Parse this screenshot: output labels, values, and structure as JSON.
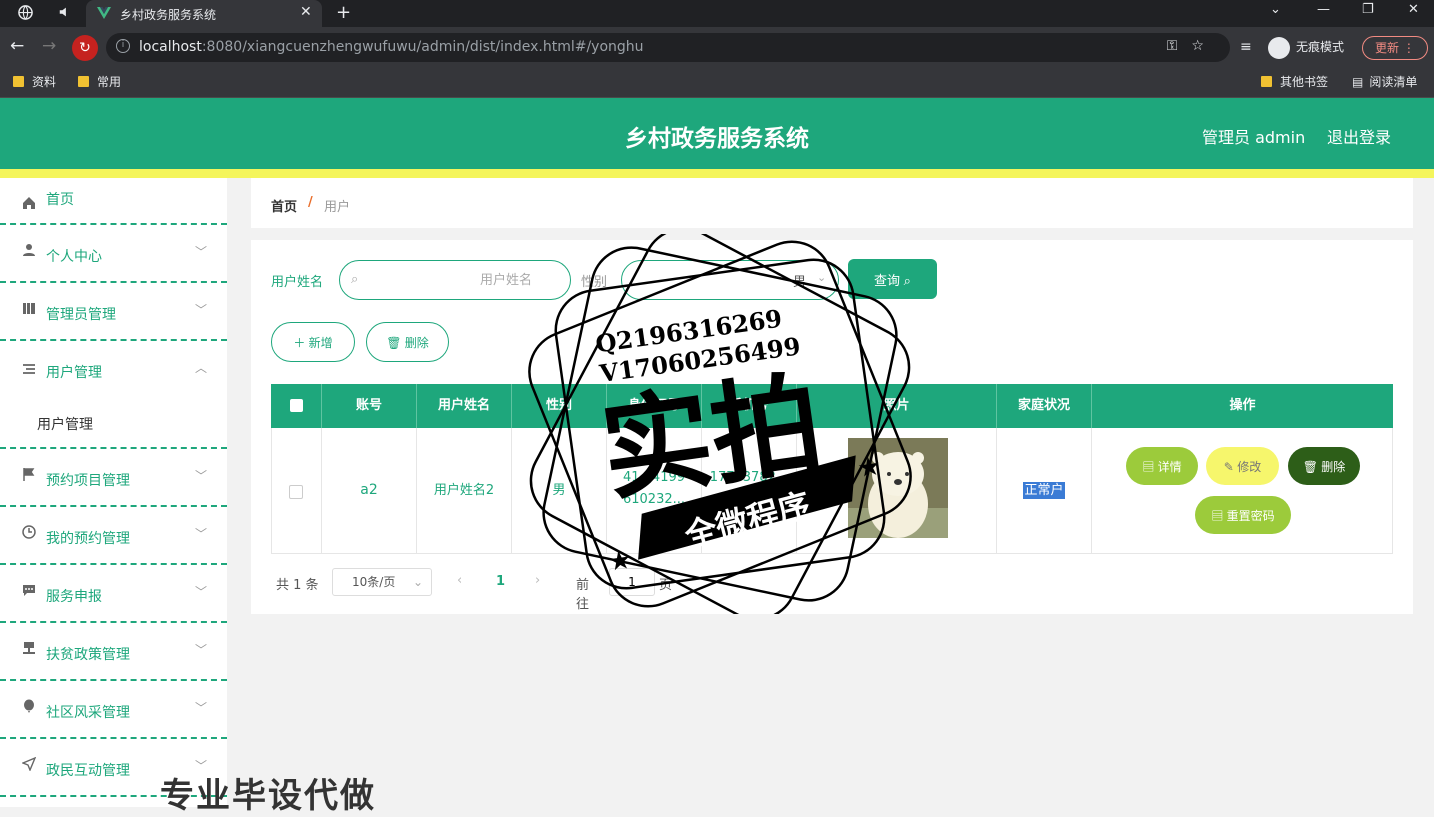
{
  "browser": {
    "tab_title": "乡村政务服务系统",
    "url_host": "localhost",
    "url_rest": ":8080/xiangcuenzhengwufuwu/admin/dist/index.html#/yonghu",
    "incognito_label": "无痕模式",
    "update_label": "更新",
    "bookmarks": [
      "资料",
      "常用"
    ],
    "other_bookmarks": "其他书签",
    "reading_list": "阅读清单"
  },
  "header": {
    "title": "乡村政务服务系统",
    "user_label": "管理员 admin",
    "logout_label": "退出登录",
    "accent": "#1ea77c",
    "stripe": "#f4f55c"
  },
  "sidebar": {
    "items": [
      {
        "label": "首页",
        "icon": "home-icon"
      },
      {
        "label": "个人中心",
        "icon": "person-icon"
      },
      {
        "label": "管理员管理",
        "icon": "book-icon"
      },
      {
        "label": "用户管理",
        "icon": "list-icon"
      },
      {
        "label": "预约项目管理",
        "icon": "flag-icon"
      },
      {
        "label": "我的预约管理",
        "icon": "clock-icon"
      },
      {
        "label": "服务申报",
        "icon": "chat-icon"
      },
      {
        "label": "扶贫政策管理",
        "icon": "stamp-icon"
      },
      {
        "label": "社区风采管理",
        "icon": "balloon-icon"
      },
      {
        "label": "政民互动管理",
        "icon": "send-icon"
      }
    ],
    "submenu_label": "用户管理"
  },
  "breadcrumb": {
    "home": "首页",
    "separator": "/",
    "current": "用户"
  },
  "search": {
    "name_label": "用户姓名",
    "name_placeholder": "用户姓名",
    "gender_label": "性别",
    "gender_value": "男",
    "query_label": "查询"
  },
  "actions": {
    "add_label": "新增",
    "delete_label": "删除"
  },
  "table": {
    "columns": [
      "账号",
      "用户姓名",
      "性别",
      "身份证号",
      "手机号",
      "照片",
      "家庭状况",
      "操作"
    ],
    "rows": [
      {
        "account": "a2",
        "name": "用户姓名2",
        "gender": "男",
        "id_line1": "41...4199",
        "id_line2": "610232...",
        "phone": "17703782...",
        "status": "正常户"
      }
    ],
    "row_actions": {
      "detail": "详情",
      "edit": "修改",
      "delete": "删除",
      "reset": "重置密码"
    }
  },
  "pagination": {
    "total": "共 1 条",
    "page_size": "10条/页",
    "current": "1",
    "goto_label": "前往",
    "goto_value": "1",
    "page_suffix": "页"
  },
  "watermark": {
    "qq": "Q2196316269",
    "vx": "V17060256499",
    "big": "实拍",
    "ribbon": "全微程序",
    "bottom": "专业毕设代做"
  }
}
